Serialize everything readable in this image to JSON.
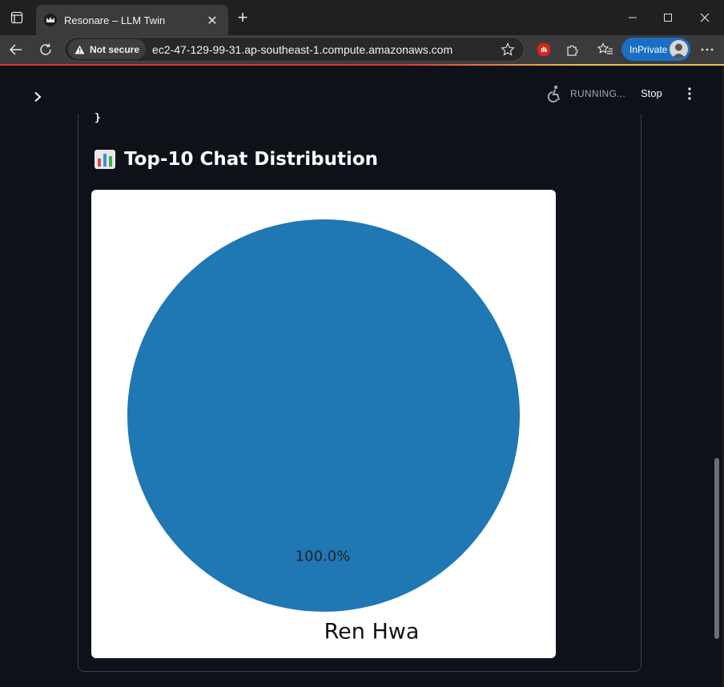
{
  "browser": {
    "tab_title": "Resonare – LLM Twin",
    "security_label": "Not secure",
    "url": "ec2-47-129-99-31.ap-southeast-1.compute.amazonaws.com",
    "inprivate_label": "InPrivate",
    "new_tab_symbol": "+",
    "close_symbol": "✕"
  },
  "app": {
    "status_text": "RUNNING...",
    "stop_label": "Stop",
    "code_tail": "}",
    "section": {
      "emoji": "📊",
      "title": "Top-10 Chat Distribution"
    }
  },
  "chart_data": {
    "type": "pie",
    "title": "",
    "slices": [
      {
        "label": "Ren Hwa",
        "value": 100.0,
        "pct_label": "100.0%",
        "color": "#1f77b4"
      }
    ]
  },
  "colors": {
    "app_bg": "#0e1117",
    "browser_chrome": "#3b3b3b",
    "accent_blue": "#1a6fc4",
    "pie_blue": "#1f77b4"
  }
}
